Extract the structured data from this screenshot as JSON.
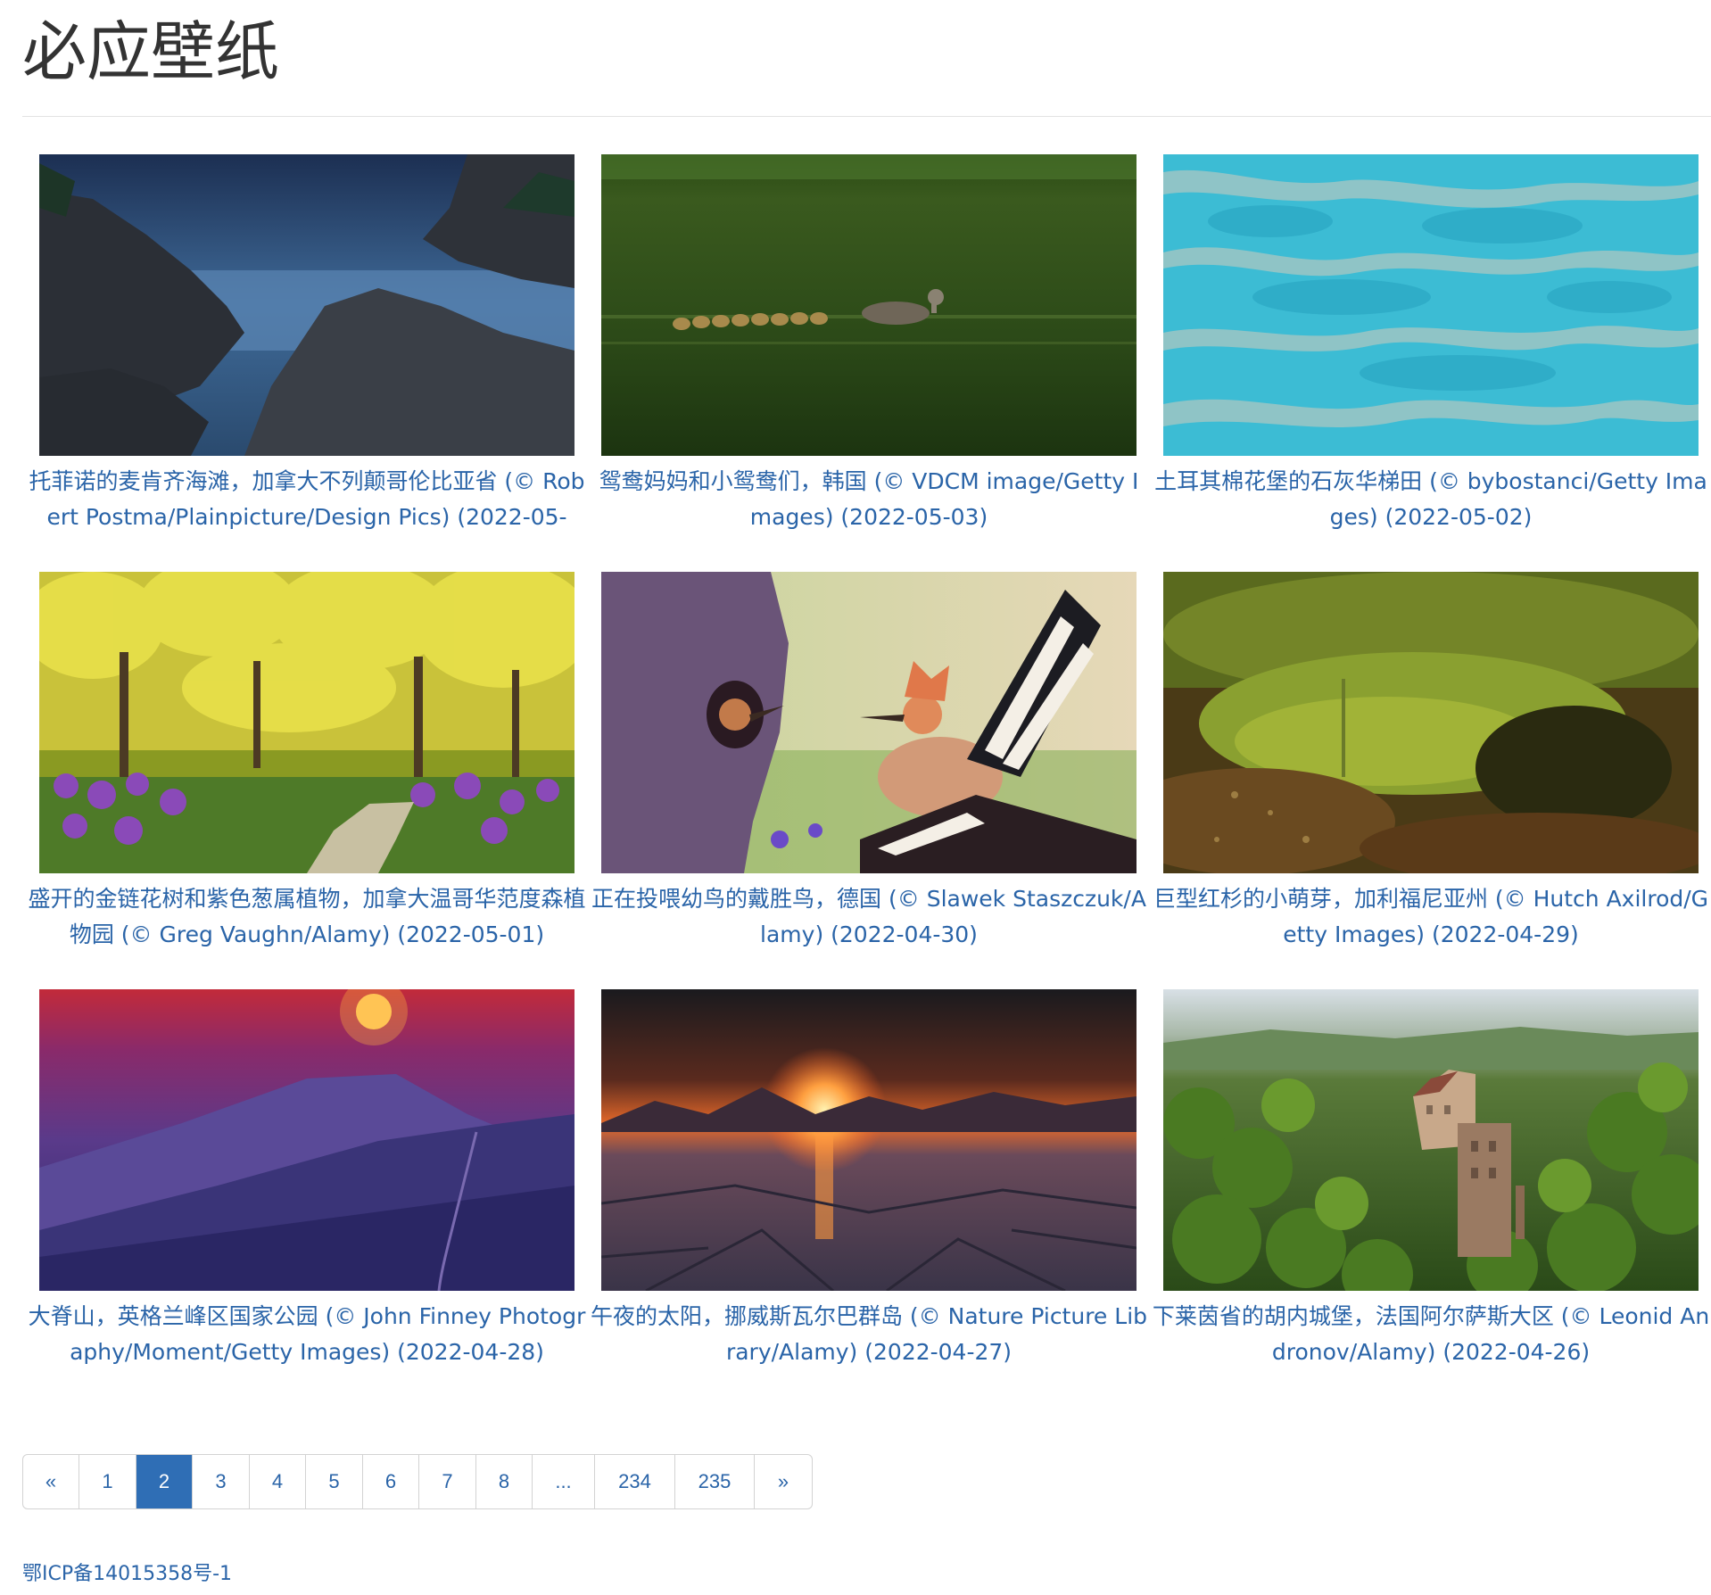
{
  "site": {
    "title": "必应壁纸"
  },
  "wallpapers": [
    {
      "caption": "托菲诺的麦肯齐海滩，加拿大不列颠哥伦比亚省 (© Robert Postma/Plainpicture/Design Pics) (2022-05-",
      "image": "rocky-coast-blue-dusk"
    },
    {
      "caption": "鸳鸯妈妈和小鸳鸯们，韩国 (© VDCM image/Getty Images) (2022-05-03)",
      "image": "mandarin-ducks-green-water"
    },
    {
      "caption": "土耳其棉花堡的石灰华梯田 (© bybostanci/Getty Images) (2022-05-02)",
      "image": "turquoise-travertine-terraces"
    },
    {
      "caption": "盛开的金链花树和紫色葱属植物，加拿大温哥华范度森植物园 (© Greg Vaughn/Alamy) (2022-05-01)",
      "image": "golden-chain-trees-purple-flowers"
    },
    {
      "caption": "正在投喂幼鸟的戴胜鸟，德国 (© Slawek Staszczuk/Alamy) (2022-04-30)",
      "image": "hoopoe-feeding-chick"
    },
    {
      "caption": "巨型红杉的小萌芽，加利福尼亚州 (© Hutch Axilrod/Getty Images) (2022-04-29)",
      "image": "redwood-sprout-moss"
    },
    {
      "caption": "大脊山，英格兰峰区国家公园 (© John Finney Photography/Moment/Getty Images) (2022-04-28)",
      "image": "purple-hills-sunset"
    },
    {
      "caption": "午夜的太阳，挪威斯瓦尔巴群岛 (© Nature Picture Library/Alamy) (2022-04-27)",
      "image": "midnight-sun-ice"
    },
    {
      "caption": "下莱茵省的胡内城堡，法国阿尔萨斯大区 (© Leonid Andronov/Alamy) (2022-04-26)",
      "image": "castle-in-forest"
    }
  ],
  "pagination": {
    "items": [
      {
        "label": "«",
        "active": false
      },
      {
        "label": "1",
        "active": false
      },
      {
        "label": "2",
        "active": true
      },
      {
        "label": "3",
        "active": false
      },
      {
        "label": "4",
        "active": false
      },
      {
        "label": "5",
        "active": false
      },
      {
        "label": "6",
        "active": false
      },
      {
        "label": "7",
        "active": false
      },
      {
        "label": "8",
        "active": false
      },
      {
        "label": "...",
        "active": false
      },
      {
        "label": "234",
        "active": false
      },
      {
        "label": "235",
        "active": false
      },
      {
        "label": "»",
        "active": false
      }
    ]
  },
  "footer": {
    "icp": "鄂ICP备14015358号-1"
  },
  "colors": {
    "link": "#2a64a8",
    "active_page_bg": "#2f6eb5",
    "border": "#d3d3d3"
  }
}
